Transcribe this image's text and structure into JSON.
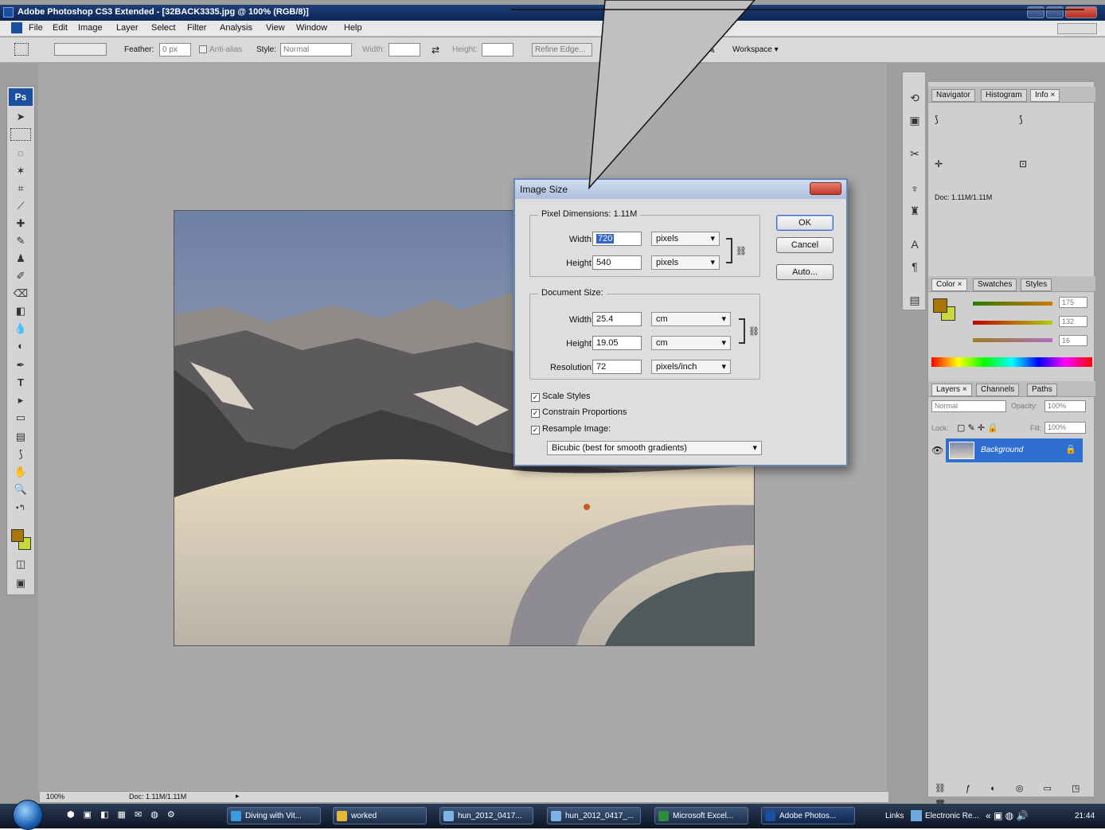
{
  "window": {
    "title": "Adobe Photoshop CS3 Extended - [32BACK3335.jpg @ 100% (RGB/8)]"
  },
  "menu": [
    "File",
    "Edit",
    "Image",
    "Layer",
    "Select",
    "Filter",
    "Analysis",
    "View",
    "Window",
    "Help"
  ],
  "options": {
    "feather_label": "Feather:",
    "feather_value": "0 px",
    "antialias_label": "Anti-alias",
    "style_label": "Style:",
    "style_value": "Normal",
    "width_label": "Width:",
    "height_label": "Height:",
    "refine_edge": "Refine Edge...",
    "workspace": "Workspace ▾"
  },
  "toolbox": {
    "logo": "Ps"
  },
  "statusbar": {
    "zoom": "100%",
    "doc": "Doc: 1.11M/1.11M"
  },
  "dialog": {
    "title": "Image Size",
    "pixel_dimensions_label": "Pixel Dimensions:  1.11M",
    "px_width_label": "Width:",
    "px_width_value": "720",
    "px_width_unit": "pixels",
    "px_height_label": "Height:",
    "px_height_value": "540",
    "px_height_unit": "pixels",
    "document_size_label": "Document Size:",
    "doc_width_label": "Width:",
    "doc_width_value": "25.4",
    "doc_width_unit": "cm",
    "doc_height_label": "Height:",
    "doc_height_value": "19.05",
    "doc_height_unit": "cm",
    "resolution_label": "Resolution:",
    "resolution_value": "72",
    "resolution_unit": "pixels/inch",
    "scale_styles": "Scale Styles",
    "constrain": "Constrain Proportions",
    "resample": "Resample Image:",
    "method": "Bicubic (best for smooth gradients)",
    "ok": "OK",
    "cancel": "Cancel",
    "auto": "Auto..."
  },
  "panels": {
    "top_tabs": [
      "Navigator",
      "Histogram",
      "Info ×"
    ],
    "info_doc": "Doc: 1.11M/1.11M",
    "color_tabs": [
      "Color ×",
      "Swatches",
      "Styles"
    ],
    "color_values": {
      "r": "175",
      "g": "132",
      "b": "16"
    },
    "layer_tabs": [
      "Layers ×",
      "Channels",
      "Paths"
    ],
    "blend_mode": "Normal",
    "opacity_label": "Opacity:",
    "opacity_value": "100%",
    "lock_label": "Lock:",
    "fill_label": "Fill:",
    "fill_value": "100%",
    "layer_name": "Background"
  },
  "taskbar": {
    "items": [
      "Diving with Vit...",
      "worked",
      "hun_2012_0417...",
      "hun_2012_0417_...",
      "Microsoft Excel...",
      "Adobe Photos..."
    ],
    "links": "Links",
    "tray": "Electronic Re...",
    "clock": "21:44"
  },
  "colors": {
    "fg": "#a9760a",
    "bg": "#cbd83a",
    "accent": "#2f6fd1"
  }
}
